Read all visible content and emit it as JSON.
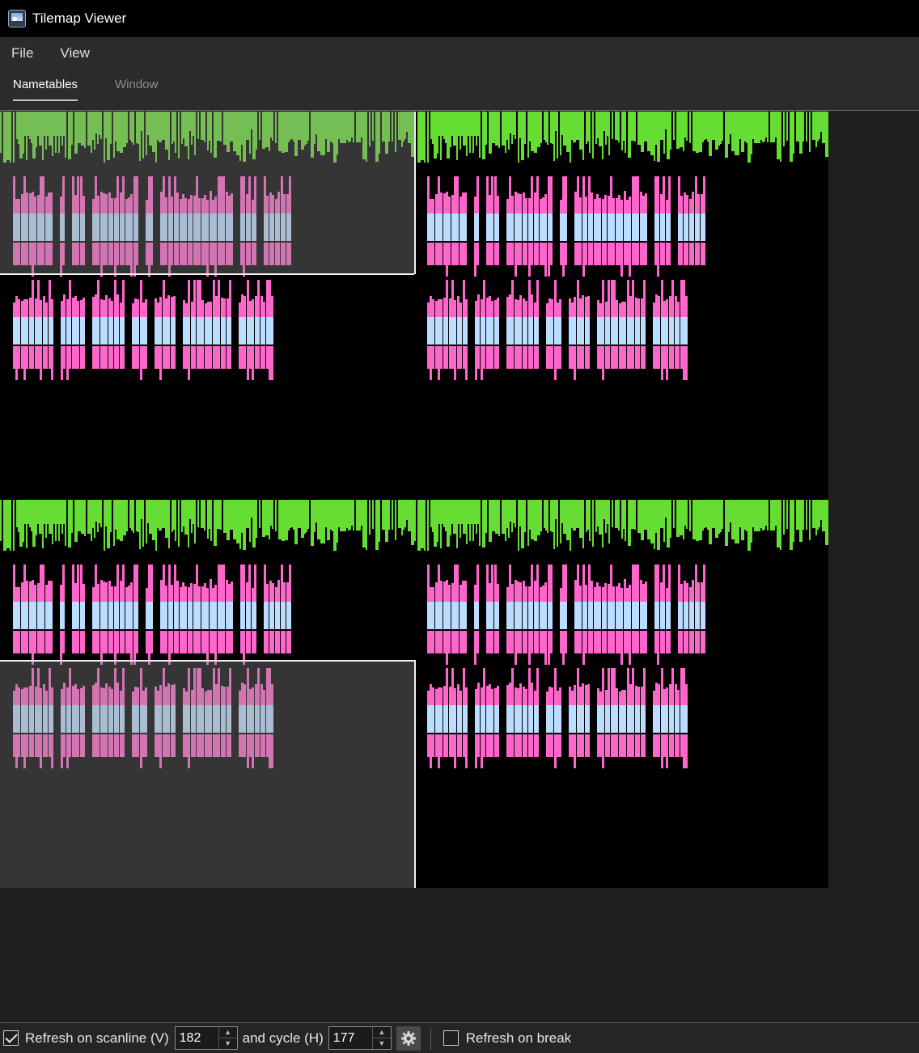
{
  "window": {
    "title": "Tilemap Viewer",
    "icon": "picture-icon"
  },
  "menu": [
    {
      "label": "File"
    },
    {
      "label": "View"
    }
  ],
  "tabs": [
    {
      "label": "Nametables",
      "active": true
    },
    {
      "label": "Window",
      "active": false
    }
  ],
  "nametables": {
    "count": 4,
    "tile_colors": {
      "status_bar": "#66dd33",
      "text_primary": "#ff66cc",
      "text_secondary": "#bbddff",
      "background": "#000000",
      "viewport_tint": "#8c8c8c"
    },
    "text_lines": [
      "Press B to perform a high-speed air dash.",
      "Unlock more moves as you explore more!"
    ]
  },
  "statusbar": {
    "refresh_scanline_checked": true,
    "refresh_scanline_label": "Refresh on scanline (V)",
    "scanline_value": "182",
    "cycle_label": "and cycle (H)",
    "cycle_value": "177",
    "gear_icon": "gear-icon",
    "refresh_break_checked": false,
    "refresh_break_label": "Refresh on break"
  }
}
